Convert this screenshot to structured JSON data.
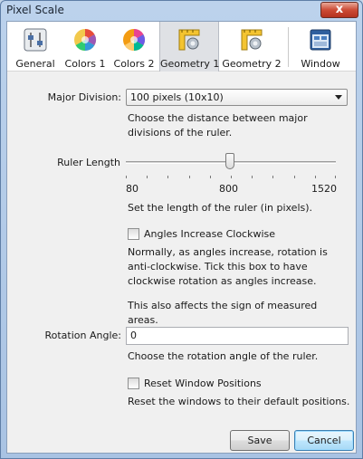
{
  "window": {
    "title": "Pixel Scale",
    "close_label": "x"
  },
  "toolbar": {
    "tabs": [
      {
        "label": "General",
        "icon": "general-settings-icon"
      },
      {
        "label": "Colors 1",
        "icon": "color-wheel-icon"
      },
      {
        "label": "Colors 2",
        "icon": "color-wheel-icon"
      },
      {
        "label": "Geometry 1",
        "icon": "ruler-gear-icon",
        "active": true
      },
      {
        "label": "Geometry 2",
        "icon": "ruler-gear-icon"
      },
      {
        "label": "Window",
        "icon": "window-icon"
      }
    ]
  },
  "major_division": {
    "label": "Major Division:",
    "value": "100 pixels (10x10)",
    "description": "Choose the distance between major divisions of the ruler."
  },
  "ruler_length": {
    "label": "Ruler Length",
    "min_label": "80",
    "mid_label": "800",
    "max_label": "1520",
    "value": 800,
    "description": "Set the length of the ruler (in pixels)."
  },
  "angles_clockwise": {
    "label": "Angles Increase Clockwise",
    "checked": false,
    "description": "Normally, as angles increase, rotation is anti-clockwise. Tick this box to have clockwise rotation as angles increase.",
    "note": "This also affects the sign of measured areas."
  },
  "rotation_angle": {
    "label": "Rotation Angle:",
    "value": "0",
    "description": "Choose the rotation angle of the ruler."
  },
  "reset_windows": {
    "label": "Reset Window Positions",
    "checked": false,
    "description": "Reset the windows to their default positions."
  },
  "buttons": {
    "save": "Save",
    "cancel": "Cancel"
  },
  "colors": {
    "accent": "#3c7fb1",
    "panel": "#f0f0f0",
    "frame": "#bcd2ec"
  }
}
